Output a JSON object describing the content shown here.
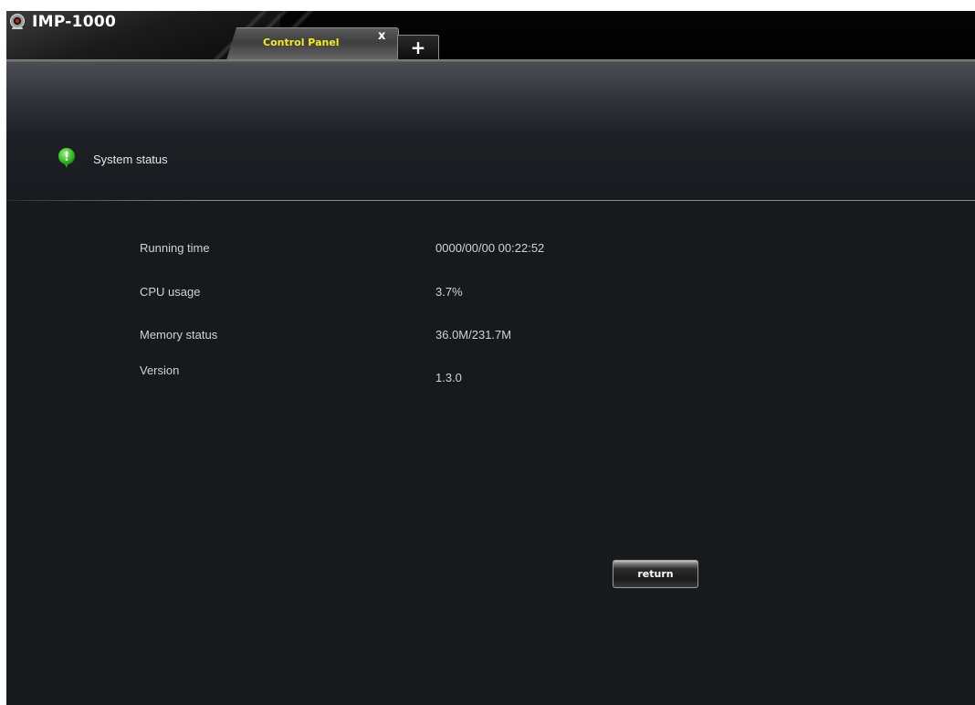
{
  "app": {
    "title": "IMP-1000",
    "logo_icon": "camera-icon"
  },
  "tabs": [
    {
      "label": "Control Panel",
      "active": true,
      "close_glyph": "x",
      "label_color": "#f2ee1d"
    }
  ],
  "add_tab_glyph": "+",
  "section": {
    "title": "System status",
    "icon": "info-bubble-icon",
    "icon_color": "#39c22a"
  },
  "status_rows": [
    {
      "label": "Running time",
      "value": "0000/00/00 00:22:52"
    },
    {
      "label": "CPU usage",
      "value": "3.7%"
    },
    {
      "label": "Memory status",
      "value": "36.0M/231.7M"
    },
    {
      "label": "Version",
      "value": "1.3.0"
    }
  ],
  "return_button": "return",
  "colors": {
    "background": "#171a1d",
    "text": "#d2d2d2",
    "tab_label": "#f2ee1d"
  }
}
